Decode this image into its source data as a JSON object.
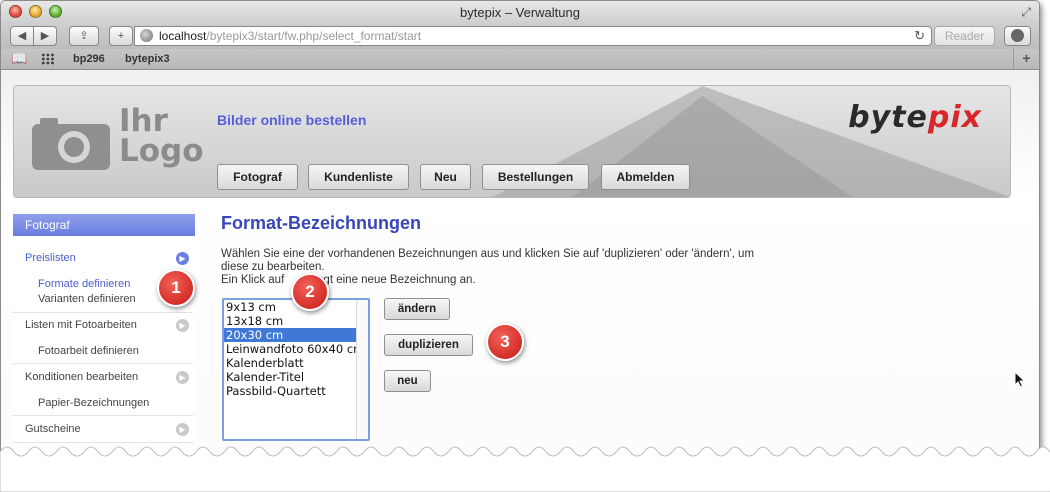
{
  "window": {
    "title": "bytepix – Verwaltung"
  },
  "toolbar": {
    "url_host": "localhost",
    "url_path": "/bytepix3/start/fw.php/select_format/start",
    "reader_label": "Reader"
  },
  "bookmarks": {
    "items": [
      "bp296",
      "bytepix3"
    ]
  },
  "header": {
    "logo_line1": "Ihr",
    "logo_line2": "Logo",
    "tagline": "Bilder online bestellen",
    "brand_main": "byte",
    "brand_accent": "pix",
    "nav": [
      "Fotograf",
      "Kundenliste",
      "Neu",
      "Bestellungen",
      "Abmelden"
    ]
  },
  "sidebar": {
    "heading": "Fotograf",
    "items": [
      "Preislisten",
      "Formate definieren",
      "Varianten definieren",
      "Listen mit Fotoarbeiten",
      "Fotoarbeit definieren",
      "Konditionen bearbeiten",
      "Papier-Bezeichnungen",
      "Gutscheine"
    ]
  },
  "content": {
    "title": "Format-Bezeichnungen",
    "para_line1": "Wählen Sie eine der vorhandenen Bezeichnungen aus und klicken Sie auf 'duplizieren' oder 'ändern', um",
    "para_line2": "diese zu bearbeiten.",
    "para_line3_start": "Ein Klick auf ",
    "para_line3_end": "legt eine neue Bezeichnung an.",
    "formats": [
      "9x13 cm",
      "13x18 cm",
      "20x30 cm",
      "Leinwandfoto 60x40 cm",
      "Kalenderblatt",
      "Kalender-Titel",
      "Passbild-Quartett"
    ],
    "selected_format": "20x30 cm",
    "btn_change": "ändern",
    "btn_duplicate": "duplizieren",
    "btn_new": "neu"
  },
  "annotations": [
    "1",
    "2",
    "3"
  ],
  "colors": {
    "accent_blue": "#3846b8",
    "sidebar_head": "#6a7ddf",
    "selection": "#3f78d6",
    "badge_red": "#d42e28"
  }
}
